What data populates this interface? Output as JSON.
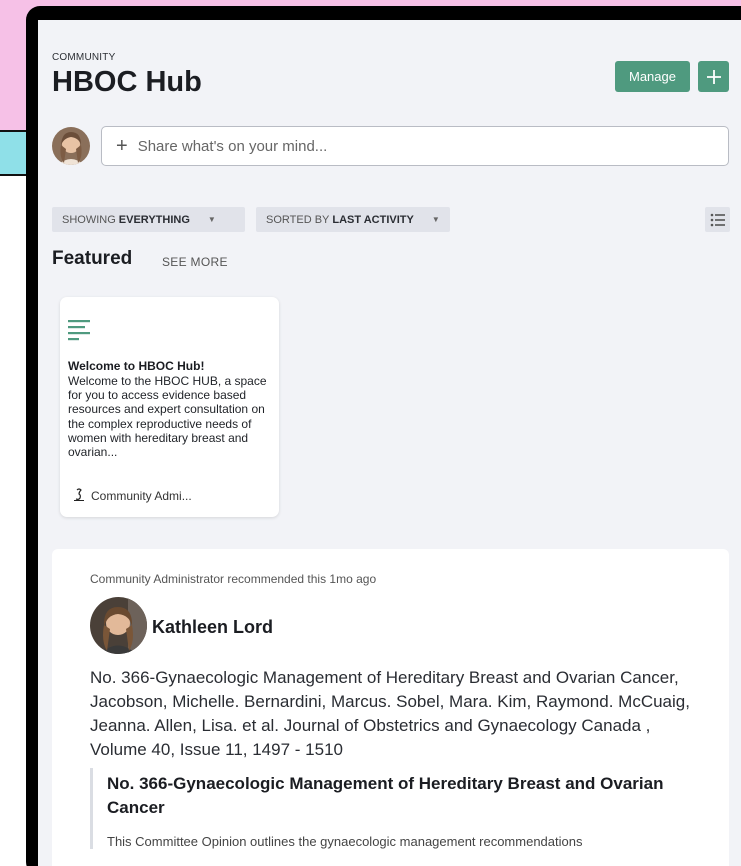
{
  "header": {
    "kicker": "COMMUNITY",
    "title": "HBOC Hub",
    "manage_label": "Manage"
  },
  "composer": {
    "placeholder": "Share what's on your mind..."
  },
  "filters": {
    "showing_prefix": "SHOWING",
    "showing_value": "EVERYTHING",
    "sorted_prefix": "SORTED BY",
    "sorted_value": "LAST ACTIVITY"
  },
  "featured": {
    "heading": "Featured",
    "see_more": "SEE MORE",
    "cards": [
      {
        "title": "Welcome to HBOC Hub!",
        "text": "Welcome to the HBOC HUB, a space for you to access evidence based resources and expert consultation on the complex reproductive needs of women with hereditary breast and ovarian...",
        "author": "Community Admi..."
      }
    ]
  },
  "post": {
    "meta": "Community Administrator recommended this 1mo ago",
    "author": "Kathleen Lord",
    "body": "No. 366-Gynaecologic Management of Hereditary Breast and Ovarian Cancer, Jacobson, Michelle. Bernardini, Marcus. Sobel, Mara. Kim, Raymond. McCuaig, Jeanna. Allen, Lisa. et al. Journal of Obstetrics and Gynaecology Canada , Volume 40, Issue 11, 1497 - 1510",
    "quote_title": "No. 366-Gynaecologic Management of Hereditary Breast and Ovarian Cancer",
    "quote_text": "This Committee Opinion outlines the gynaecologic management recommendations"
  },
  "colors": {
    "accent": "#4f9a7f",
    "background_pink": "#f6c1e7",
    "background_cyan": "#8fe0e8",
    "screen": "#f2f3f7"
  },
  "icons": [
    "plus-icon",
    "list-view-icon",
    "document-icon",
    "admin-avatar-icon",
    "caret-down-icon"
  ]
}
